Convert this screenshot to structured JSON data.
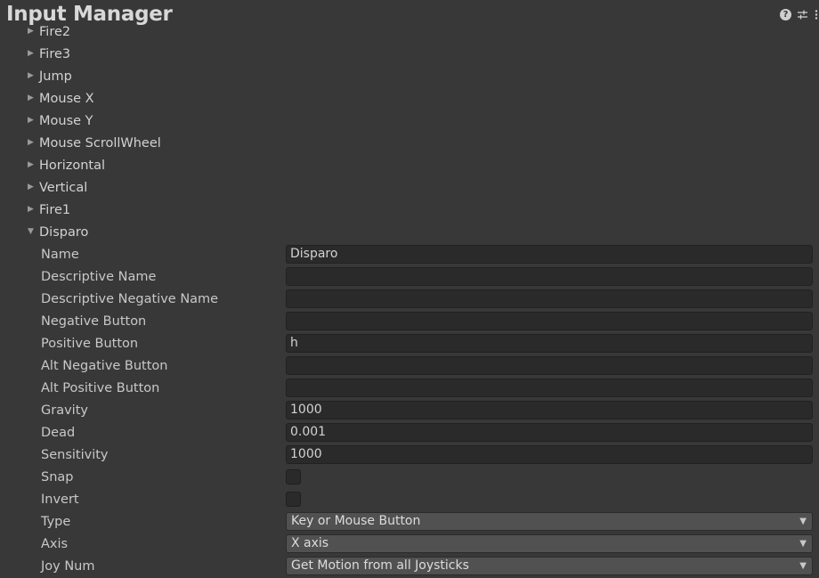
{
  "header": {
    "title": "Input Manager",
    "icons": [
      "help-icon",
      "settings-sliders-icon",
      "more-menu-icon"
    ]
  },
  "axes_collapsed": [
    {
      "label": "Fire2",
      "name": "fire2"
    },
    {
      "label": "Fire3",
      "name": "fire3"
    },
    {
      "label": "Jump",
      "name": "jump"
    },
    {
      "label": "Mouse X",
      "name": "mouse-x"
    },
    {
      "label": "Mouse Y",
      "name": "mouse-y"
    },
    {
      "label": "Mouse ScrollWheel",
      "name": "mouse-scrollwheel"
    },
    {
      "label": "Horizontal",
      "name": "horizontal"
    },
    {
      "label": "Vertical",
      "name": "vertical"
    },
    {
      "label": "Fire1",
      "name": "fire1"
    }
  ],
  "expanded_axis": {
    "label": "Disparo",
    "properties": {
      "name": {
        "label": "Name",
        "value": "Disparo"
      },
      "descriptive_name": {
        "label": "Descriptive Name",
        "value": ""
      },
      "descriptive_negative_name": {
        "label": "Descriptive Negative Name",
        "value": ""
      },
      "negative_button": {
        "label": "Negative Button",
        "value": ""
      },
      "positive_button": {
        "label": "Positive Button",
        "value": "h"
      },
      "alt_negative_button": {
        "label": "Alt Negative Button",
        "value": ""
      },
      "alt_positive_button": {
        "label": "Alt Positive Button",
        "value": ""
      },
      "gravity": {
        "label": "Gravity",
        "value": "1000"
      },
      "dead": {
        "label": "Dead",
        "value": "0.001"
      },
      "sensitivity": {
        "label": "Sensitivity",
        "value": "1000"
      },
      "snap": {
        "label": "Snap",
        "checked": false
      },
      "invert": {
        "label": "Invert",
        "checked": false
      },
      "type": {
        "label": "Type",
        "value": "Key or Mouse Button"
      },
      "axis": {
        "label": "Axis",
        "value": "X axis"
      },
      "joy_num": {
        "label": "Joy Num",
        "value": "Get Motion from all Joysticks"
      }
    }
  }
}
